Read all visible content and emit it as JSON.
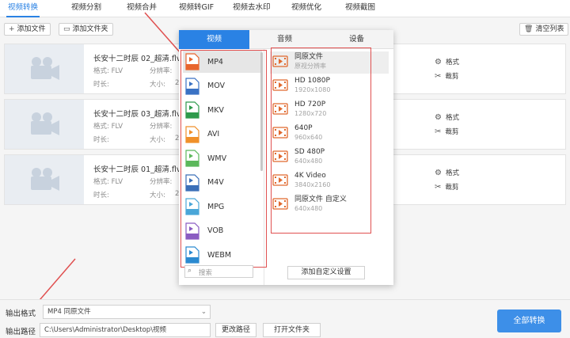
{
  "top_tabs": [
    "视频转换",
    "视频分割",
    "视频合并",
    "视频转GIF",
    "视频去水印",
    "视频优化",
    "视频截图"
  ],
  "toolbar": {
    "add_file": "添加文件",
    "add_folder": "添加文件夹",
    "clear_list": "清空列表"
  },
  "files": [
    {
      "name": "长安十二时辰 02_超清.flv",
      "format_label": "格式:",
      "format_value": "FLV",
      "res_label": "分辨率:",
      "duration_label": "时长:",
      "duration_value": "2",
      "size_label": "大小:",
      "format_action": "格式",
      "cut_action": "裁剪"
    },
    {
      "name": "长安十二时辰 03_超清.flv",
      "format_label": "格式:",
      "format_value": "FLV",
      "res_label": "分辨率:",
      "duration_label": "时长:",
      "duration_value": "2",
      "size_label": "大小:",
      "format_action": "格式",
      "cut_action": "裁剪"
    },
    {
      "name": "长安十二时辰 01_超清.flv",
      "format_label": "格式:",
      "format_value": "FLV",
      "res_label": "分辨率:",
      "duration_label": "时长:",
      "duration_value": "2",
      "size_label": "大小:",
      "format_action": "格式",
      "cut_action": "裁剪"
    }
  ],
  "popup": {
    "tabs": [
      "视频",
      "音频",
      "设备"
    ],
    "active_tab": 0,
    "formats": [
      {
        "label": "MP4",
        "color": "#e8652d"
      },
      {
        "label": "MOV",
        "color": "#3a72c4"
      },
      {
        "label": "MKV",
        "color": "#2e9a4c"
      },
      {
        "label": "AVI",
        "color": "#f0902a"
      },
      {
        "label": "WMV",
        "color": "#5cb85c"
      },
      {
        "label": "M4V",
        "color": "#3b6fb8"
      },
      {
        "label": "MPG",
        "color": "#4aa6d8"
      },
      {
        "label": "VOB",
        "color": "#8a5cc2"
      },
      {
        "label": "WEBM",
        "color": "#2b8ad0"
      }
    ],
    "selected_format": 0,
    "resolutions": [
      {
        "title": "同原文件",
        "sub": "原视分辨率"
      },
      {
        "title": "HD 1080P",
        "sub": "1920x1080"
      },
      {
        "title": "HD 720P",
        "sub": "1280x720"
      },
      {
        "title": "640P",
        "sub": "960x640"
      },
      {
        "title": "SD 480P",
        "sub": "640x480"
      },
      {
        "title": "4K Video",
        "sub": "3840x2160"
      },
      {
        "title": "同原文件 自定义",
        "sub": "640x480"
      }
    ],
    "search_placeholder": "搜索",
    "add_custom": "添加自定义设置"
  },
  "bottom": {
    "output_format_label": "输出格式",
    "output_format_value": "MP4  同原文件",
    "output_path_label": "输出路径",
    "output_path_value": "C:\\Users\\Administrator\\Desktop\\视频",
    "change_path": "更改路径",
    "open_folder": "打开文件夹",
    "convert_all": "全部转换"
  },
  "colors": {
    "accent": "#2a82e4",
    "annotation": "#e05050",
    "convert_button": "#3d8fe8"
  }
}
